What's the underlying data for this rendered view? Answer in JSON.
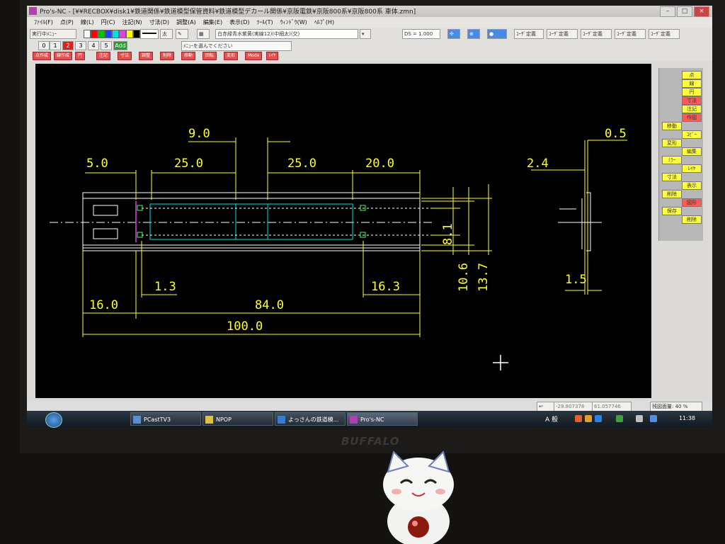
{
  "window": {
    "title": "Pro's-NC - [¥¥RECBOX¥disk1¥鉄道関係¥鉄道模型保管資料¥鉄道模型デカール関係¥京阪電鉄¥京阪800系¥京阪800系 車体.zmn]"
  },
  "menu": [
    "ﾌｧｲﾙ(F)",
    "点(P)",
    "線(L)",
    "円(C)",
    "注記(N)",
    "寸法(D)",
    "調整(A)",
    "編集(E)",
    "表示(D)",
    "ﾂｰﾙ(T)",
    "ｳｨﾝﾄﾞｳ(W)",
    "ﾍﾙﾌﾟ(H)"
  ],
  "toolbar": {
    "mode_label": "実行中ﾒﾆｭｰ",
    "font_field": "白赤緑青水紫黄(実線12)(中細太)(交)",
    "ds_field": "DS = 1.000",
    "user_buttons": [
      "ﾕｰｻﾞ定義",
      "ﾕｰｻﾞ定義",
      "ﾕｰｻﾞ定義",
      "ﾕｰｻﾞ定義",
      "ﾕｰｻﾞ定義"
    ],
    "layers": [
      "0",
      "1",
      "2",
      "3",
      "4",
      "5",
      "Add"
    ],
    "active_layer": "2",
    "hint": "ﾒﾆｭｰを選んでください",
    "cmd_tabs": [
      "点作成",
      "線作成",
      "円",
      "注記",
      "寸法",
      "調整",
      "削除",
      "移動",
      "回転",
      "変形",
      "Mode",
      "ﾚｲﾔ"
    ]
  },
  "palette": [
    "#ffffff",
    "#ff0000",
    "#00c000",
    "#2040ff",
    "#00e0e0",
    "#e040e0",
    "#ffff00",
    "#000000"
  ],
  "drawing": {
    "dims": [
      "5.0",
      "25.0",
      "9.0",
      "25.0",
      "20.0",
      "0.5",
      "2.4",
      "8.1",
      "10.6",
      "13.7",
      "1.3",
      "16.3",
      "16.0",
      "84.0",
      "100.0",
      "1.5"
    ],
    "line_color": "#ffff33",
    "part_color": "#ffffff",
    "hidden_color": "#00e0e0",
    "center_color": "#ffffff",
    "point_color": "#40ff60",
    "accent_color": "#e040e0"
  },
  "side_panel": [
    "点",
    "線",
    "円",
    "寸法",
    "注記",
    "作図",
    "移動",
    "ｺﾋﾟｰ",
    "変形",
    "編集",
    "ﾐﾗｰ",
    "ﾚｲﾔ",
    "寸法",
    "表示",
    "削除",
    "図形",
    "保存",
    "削除"
  ],
  "status": {
    "coord_x": "-29.807378",
    "coord_y": "61.057746",
    "zoom": "残図面量: 40 %"
  },
  "taskbar": {
    "tasks": [
      "PCastTV3",
      "NPOP",
      "よっさんの鉄道模...",
      "Pro's-NC"
    ],
    "ime": "A 般",
    "clock": "11:38"
  },
  "monitor": {
    "brand": "BUFFALO"
  }
}
